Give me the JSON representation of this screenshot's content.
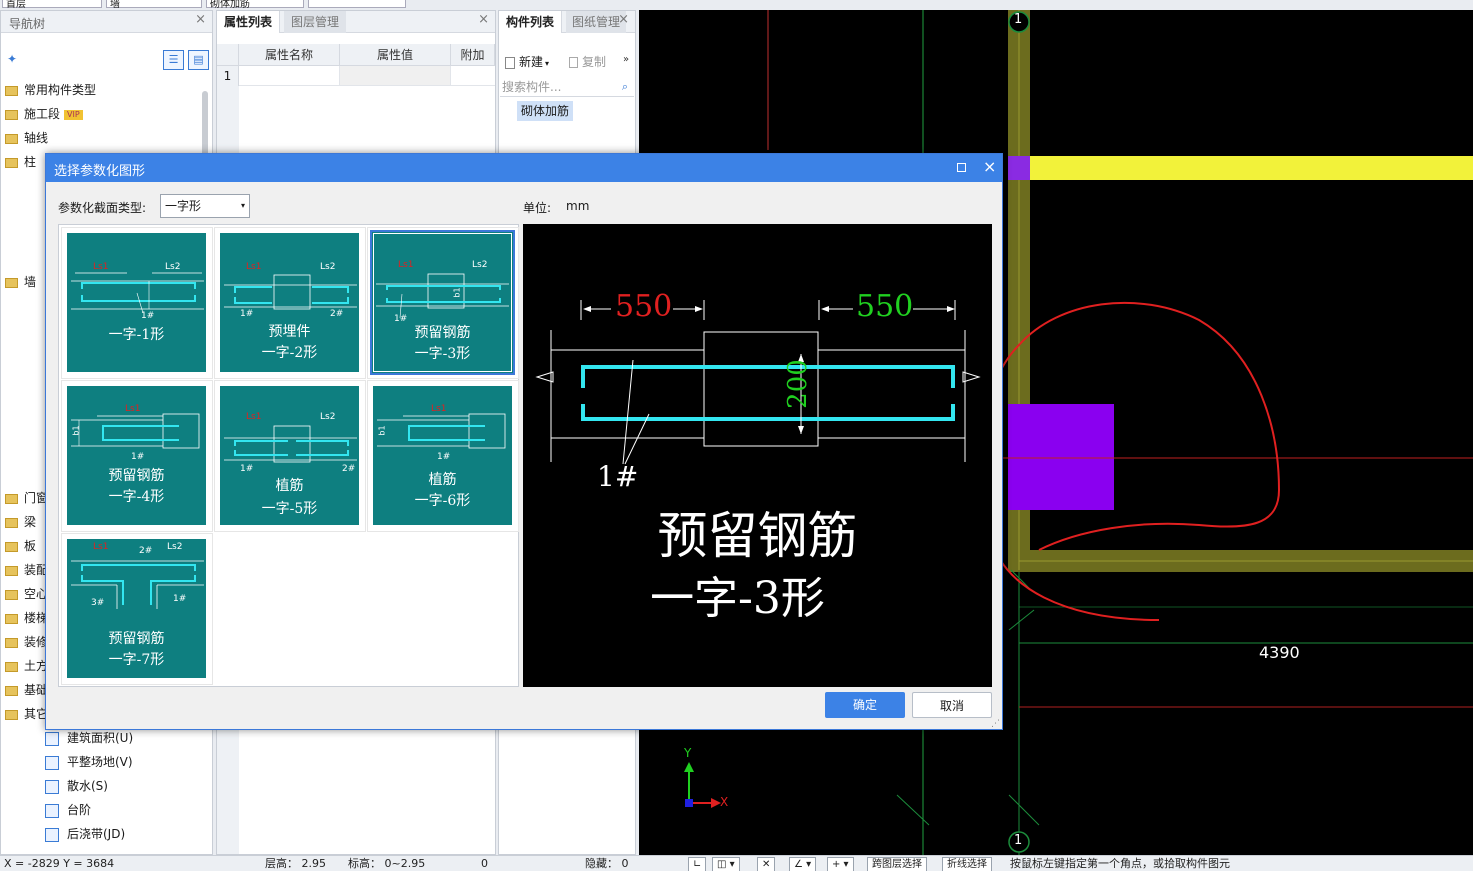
{
  "top": {
    "fields": [
      "首层",
      "墙",
      "砌体加筋",
      ""
    ]
  },
  "nav": {
    "title": "导航树",
    "items": [
      {
        "label": "常用构件类型",
        "vip": false
      },
      {
        "label": "施工段",
        "vip": true,
        "badge": "VIP"
      },
      {
        "label": "轴线",
        "vip": false
      },
      {
        "label": "柱",
        "vip": false
      }
    ],
    "wall": "墙",
    "lower": [
      "门窗",
      "梁",
      "板",
      "装配",
      "空心",
      "楼梯",
      "装修",
      "土方",
      "基础",
      "其它"
    ],
    "other_children": [
      "建筑面积(U)",
      "平整场地(V)",
      "散水(S)",
      "台阶",
      "后浇带(JD)"
    ]
  },
  "props": {
    "tabs": [
      "属性列表",
      "图层管理"
    ],
    "columns": [
      "属性名称",
      "属性值",
      "附加"
    ],
    "row1": "1"
  },
  "comp": {
    "tabs": [
      "构件列表",
      "图纸管理"
    ],
    "new_label": "新建",
    "copy_label": "复制",
    "search_placeholder": "搜索构件...",
    "selected_item": "砌体加筋"
  },
  "dialog": {
    "title": "选择参数化图形",
    "type_label": "参数化截面类型:",
    "type_value": "一字形",
    "unit_label": "单位:",
    "unit_value": "mm",
    "ok": "确定",
    "cancel": "取消",
    "shapes": [
      {
        "line1": "一字-1形",
        "line2": ""
      },
      {
        "line1": "预埋件",
        "line2": "一字-2形"
      },
      {
        "line1": "预留钢筋",
        "line2": "一字-3形"
      },
      {
        "line1": "预留钢筋",
        "line2": "一字-4形"
      },
      {
        "line1": "植筋",
        "line2": "一字-5形"
      },
      {
        "line1": "植筋",
        "line2": "一字-6形"
      },
      {
        "line1": "预留钢筋",
        "line2": "一字-7形"
      }
    ],
    "selected_index": 2,
    "thumb_marks": {
      "ls1": "Ls1",
      "ls2": "Ls2",
      "b1": "b1",
      "m1": "1#",
      "m2": "2#",
      "m3": "3#"
    },
    "preview": {
      "dim_left": "550",
      "dim_right": "550",
      "dim_height": "200",
      "marker": "1#",
      "line1": "预留钢筋",
      "line2": "一字-3形"
    }
  },
  "cad": {
    "axis_label_top": "1",
    "axis_label_bottom": "1",
    "dimension": "4390",
    "x_axis": "X",
    "y_axis": "Y"
  },
  "status": {
    "coords": "X = -2829 Y = 3684",
    "floor_height": "层高：  2.95",
    "elevation": "标高：  0~2.95",
    "zero": "0",
    "hidden": "隐藏：  0",
    "cross_layer": "跨图层选择",
    "polyline": "折线选择",
    "hint": "按鼠标左键指定第一个角点，或拾取构件图元"
  },
  "colors": {
    "accent": "#3c82e6",
    "thumb_bg": "#0e7f80",
    "rebar": "#33e6f0",
    "dim_red": "#e02020",
    "dim_green": "#20d020"
  }
}
